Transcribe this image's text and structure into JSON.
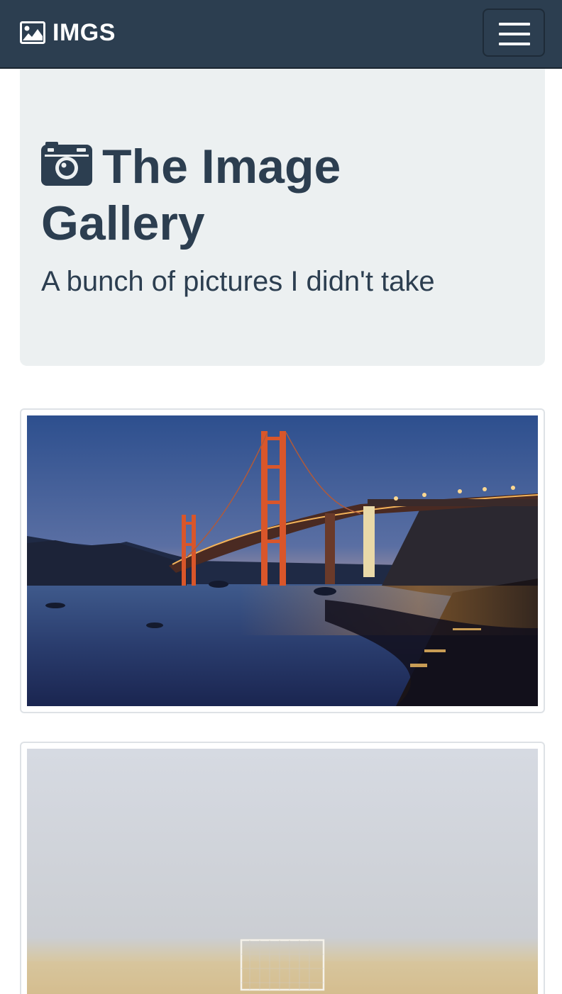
{
  "navbar": {
    "brand": "IMGS",
    "brand_icon": "image-icon",
    "menu_icon": "hamburger-menu-icon",
    "background": "#2c3e50"
  },
  "jumbotron": {
    "icon": "camera-icon",
    "title": "The Image Gallery",
    "lead": "A bunch of pictures I didn't take",
    "background": "#ecf0f1"
  },
  "gallery": [
    {
      "subject": "golden-gate-bridge-at-dusk"
    },
    {
      "subject": "foggy-beach-soccer-goal"
    }
  ]
}
